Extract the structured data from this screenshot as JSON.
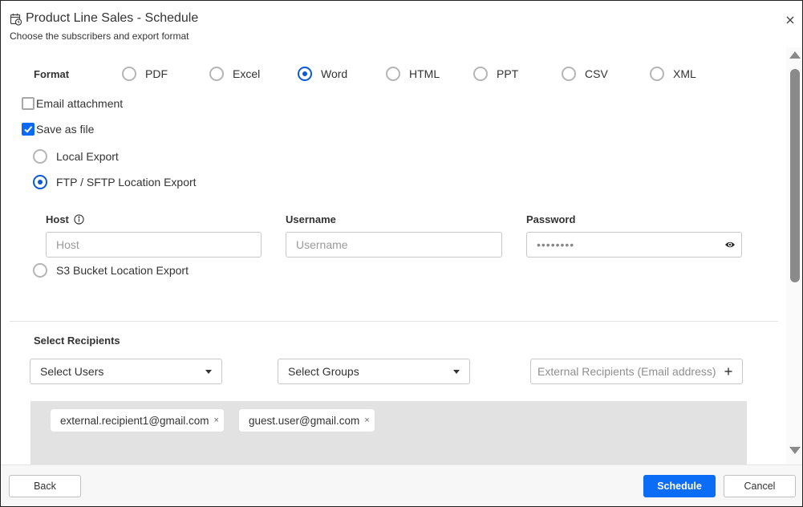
{
  "header": {
    "title": "Product Line Sales - Schedule",
    "subtitle": "Choose the subscribers and export format",
    "title_icon": "calendar-clock-icon",
    "close_icon": "close-icon"
  },
  "format": {
    "label": "Format",
    "options": [
      {
        "label": "PDF",
        "checked": false
      },
      {
        "label": "Excel",
        "checked": false
      },
      {
        "label": "Word",
        "checked": true
      },
      {
        "label": "HTML",
        "checked": false
      },
      {
        "label": "PPT",
        "checked": false
      },
      {
        "label": "CSV",
        "checked": false
      },
      {
        "label": "XML",
        "checked": false
      }
    ]
  },
  "delivery": {
    "email_attachment": {
      "label": "Email attachment",
      "checked": false
    },
    "save_as_file": {
      "label": "Save as file",
      "checked": true
    },
    "locations": [
      {
        "label": "Local Export",
        "checked": false
      },
      {
        "label": "FTP / SFTP Location Export",
        "checked": true
      },
      {
        "label": "S3 Bucket Location Export",
        "checked": false
      }
    ]
  },
  "ftp": {
    "host": {
      "label": "Host",
      "placeholder": "Host",
      "value": "",
      "info_icon": "info-icon"
    },
    "username": {
      "label": "Username",
      "placeholder": "Username",
      "value": ""
    },
    "password": {
      "label": "Password",
      "masked_value": "••••••••",
      "toggle_icon": "eye-icon"
    }
  },
  "recipients": {
    "label": "Select Recipients",
    "users_dropdown": "Select Users",
    "groups_dropdown": "Select Groups",
    "external_placeholder": "External Recipients (Email address)",
    "add_icon": "plus-icon",
    "chips": [
      {
        "email": "external.recipient1@gmail.com",
        "remove": "×"
      },
      {
        "email": "guest.user@gmail.com",
        "remove": "×"
      }
    ]
  },
  "footer": {
    "back_label": "Back",
    "schedule_label": "Schedule",
    "cancel_label": "Cancel"
  },
  "colors": {
    "accent": "#0b6cf5",
    "radio_checked": "#0a5ad6",
    "chips_background": "#e2e2e2",
    "footer_background": "#f7f7f7"
  }
}
